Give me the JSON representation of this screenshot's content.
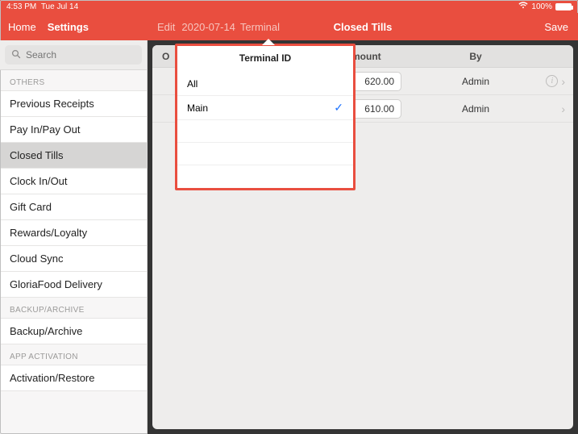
{
  "status": {
    "time": "4:53 PM",
    "date": "Tue Jul 14",
    "battery": "100%"
  },
  "topleft": {
    "home": "Home",
    "settings": "Settings"
  },
  "search": {
    "placeholder": "Search"
  },
  "sidebar": {
    "section_others": "OTHERS",
    "others": [
      "Previous Receipts",
      "Pay In/Pay Out",
      "Closed Tills",
      "Clock In/Out",
      "Gift Card",
      "Rewards/Loyalty",
      "Cloud Sync",
      "GloriaFood Delivery"
    ],
    "selected_index": 2,
    "section_backup": "BACKUP/ARCHIVE",
    "backup": [
      "Backup/Archive"
    ],
    "section_activation": "APP ACTIVATION",
    "activation": [
      "Activation/Restore"
    ]
  },
  "topright": {
    "edit": "Edit",
    "date": "2020-07-14",
    "terminal": "Terminal",
    "title": "Closed Tills",
    "save": "Save"
  },
  "table": {
    "o_label": "O",
    "amount_label": "Amount",
    "by_label": "By",
    "rows": [
      {
        "amount": "620.00",
        "by": "Admin",
        "info": true
      },
      {
        "amount": "610.00",
        "by": "Admin",
        "info": false
      }
    ]
  },
  "popover": {
    "title": "Terminal ID",
    "items": [
      {
        "label": "All",
        "checked": false
      },
      {
        "label": "Main",
        "checked": true
      }
    ]
  }
}
